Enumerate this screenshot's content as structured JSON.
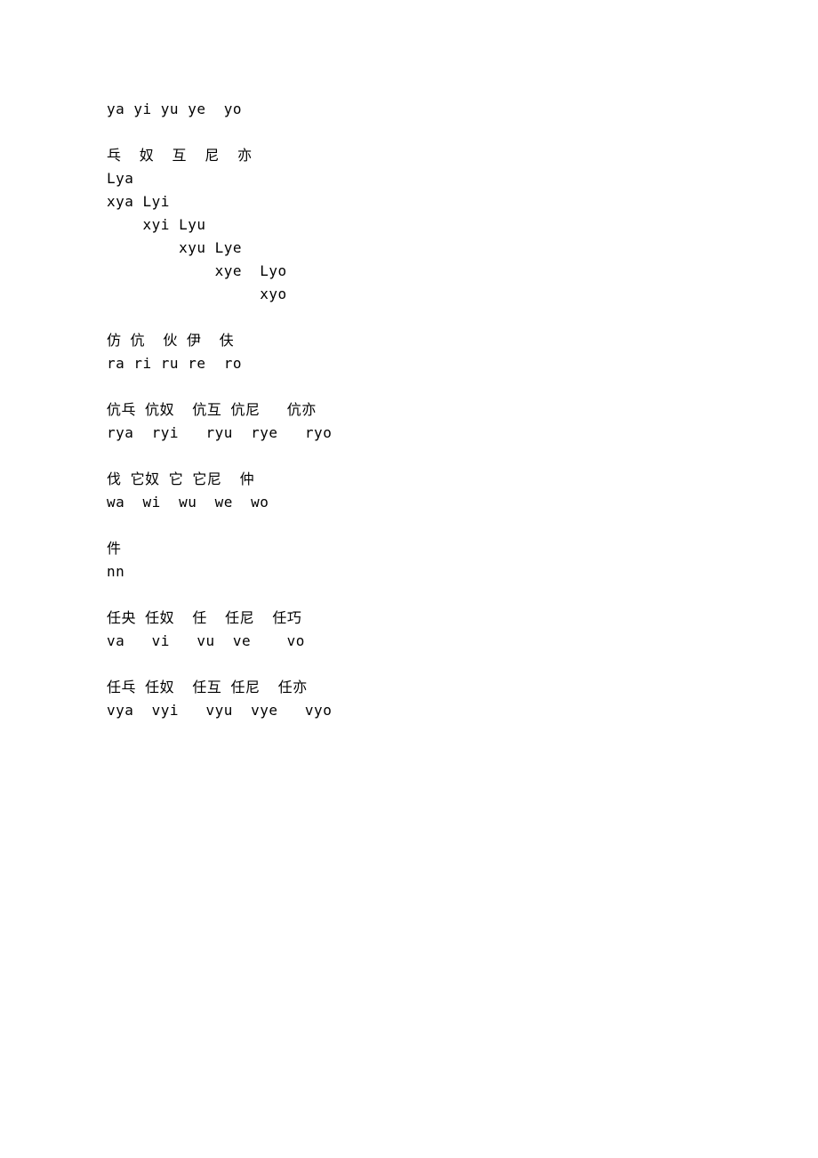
{
  "lines": {
    "l1": "ya yi yu ye  yo",
    "l2": "乓  奴  互  尼  亦",
    "l3": "Lya",
    "l4": "xya Lyi",
    "l5": "    xyi Lyu",
    "l6": "        xyu Lye",
    "l7": "            xye  Lyo",
    "l8": "                 xyo",
    "l9": "仿 伉  伙 伊  伕",
    "l10": "ra ri ru re  ro",
    "l11": "伉乓 伉奴  伉互 伉尼   伉亦",
    "l12": "rya  ryi   ryu  rye   ryo",
    "l13": "伐 它奴 它 它尼  仲",
    "l14": "wa  wi  wu  we  wo",
    "l15": "件",
    "l16": "nn",
    "l17": "任央 任奴  任  任尼  任巧",
    "l18": "va   vi   vu  ve    vo",
    "l19": "任乓 任奴  任互 任尼  任亦",
    "l20": "vya  vyi   vyu  vye   vyo"
  }
}
